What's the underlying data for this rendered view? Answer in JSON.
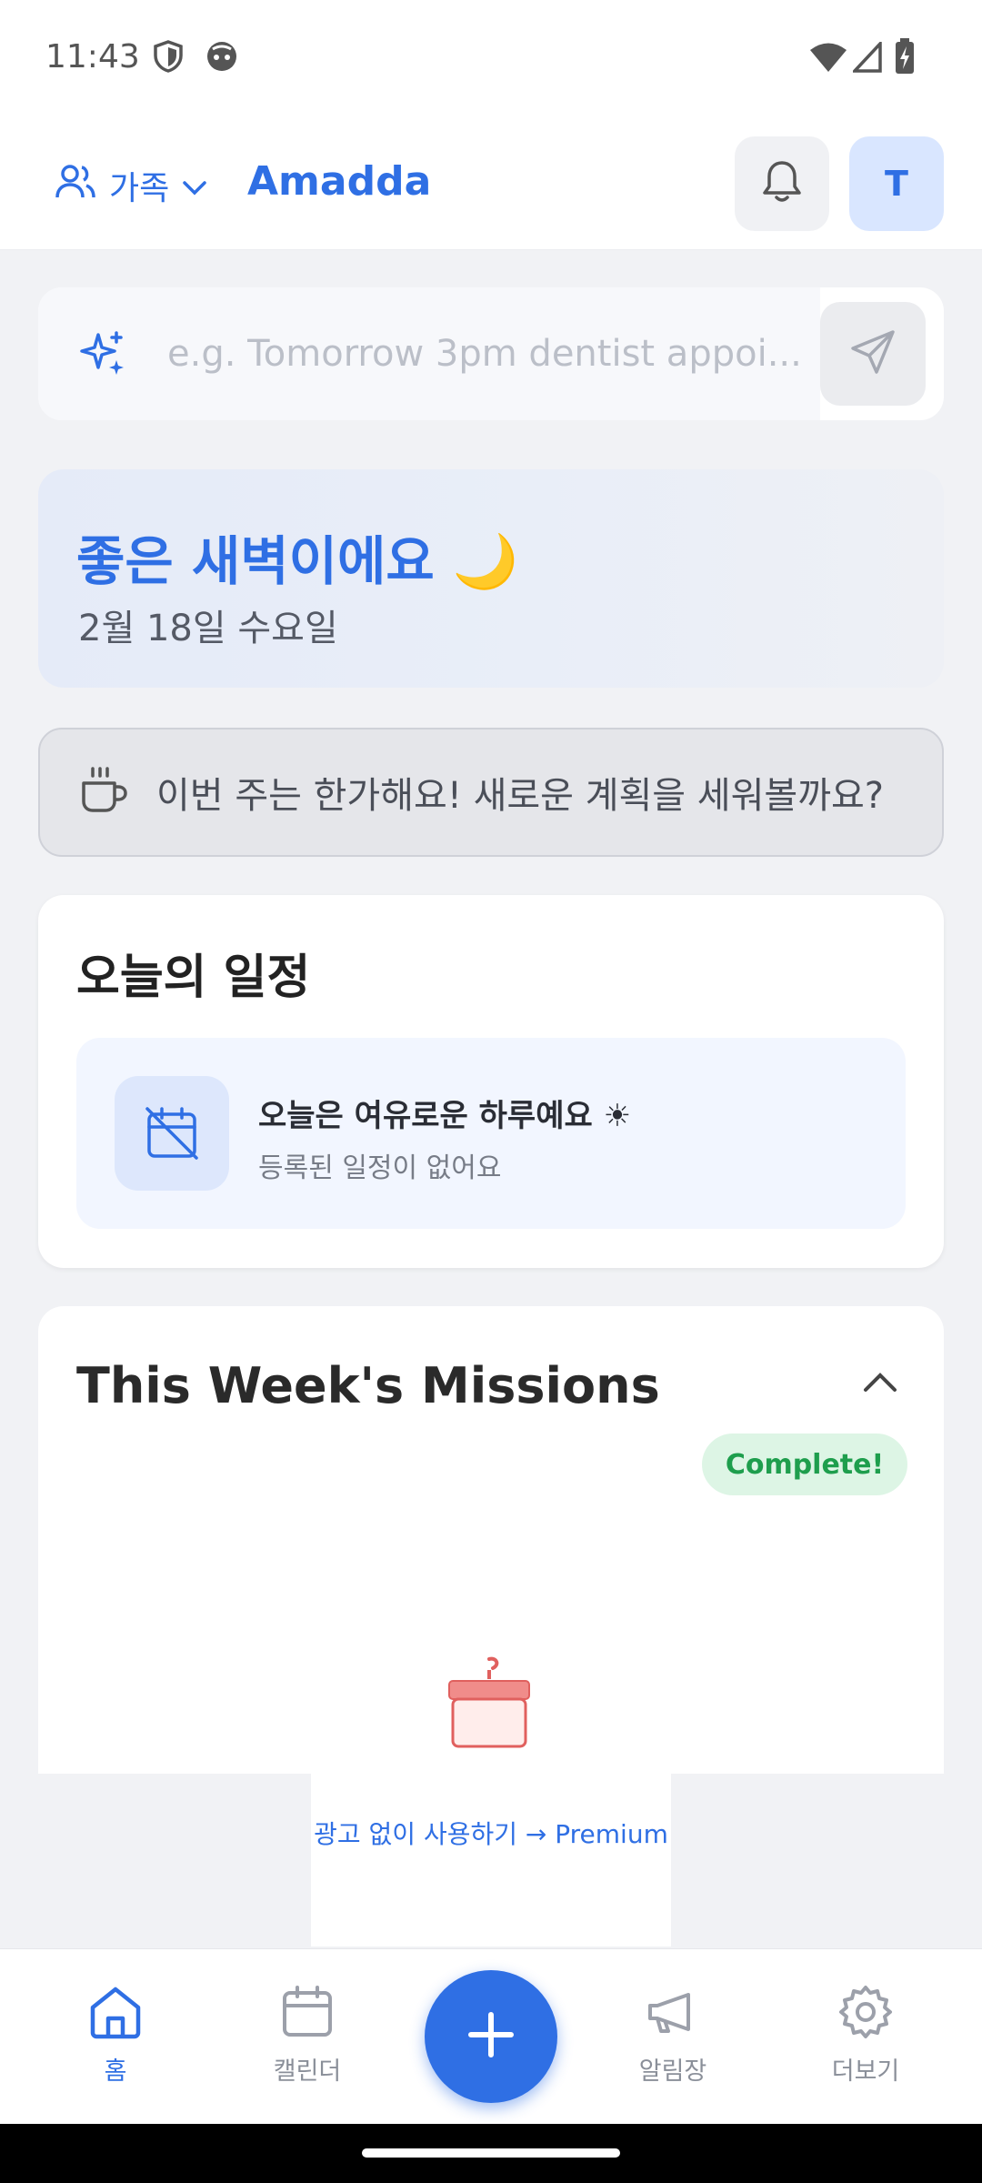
{
  "status_bar": {
    "time": "11:43"
  },
  "header": {
    "group_label": "가족",
    "app_title": "Amadda",
    "avatar_initial": "T"
  },
  "quick_add": {
    "placeholder": "e.g. Tomorrow 3pm dentist appoi..."
  },
  "greeting": {
    "title": "좋은 새벽이에요 🌙",
    "date": "2월 18일 수요일"
  },
  "tip": {
    "text": "이번 주는 한가해요! 새로운 계획을 세워볼까요?"
  },
  "today_schedule": {
    "title": "오늘의 일정",
    "empty_main": "오늘은 여유로운 하루예요 ☀",
    "empty_sub": "등록된 일정이 없어요"
  },
  "missions": {
    "title": "This Week's Missions",
    "badge": "Complete!"
  },
  "ad": {
    "text": "광고 없이 사용하기 → Premium"
  },
  "bottom_nav": {
    "items": [
      {
        "label": "홈",
        "icon": "home-icon",
        "active": true
      },
      {
        "label": "캘린더",
        "icon": "calendar-icon",
        "active": false
      },
      {
        "label": "알림장",
        "icon": "megaphone-icon",
        "active": false
      },
      {
        "label": "더보기",
        "icon": "gear-icon",
        "active": false
      }
    ]
  },
  "colors": {
    "accent": "#2F6FE4",
    "success": "#1E9E4D",
    "background": "#F1F2F5"
  }
}
